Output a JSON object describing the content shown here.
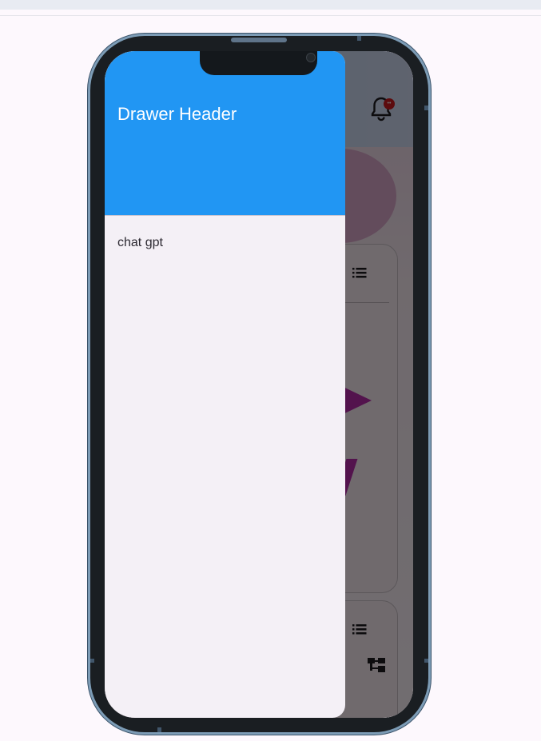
{
  "drawer": {
    "header_title": "Drawer Header",
    "items": [
      {
        "label": "chat gpt"
      }
    ]
  },
  "app": {
    "notification_badge": "••",
    "icons": [
      "bell-icon",
      "list-icon",
      "play-icon",
      "tree-icon",
      "camera-icon"
    ]
  },
  "colors": {
    "drawer_header": "#2196f3",
    "drawer_background": "#f4f0f6",
    "scrim": "rgba(0,0,0,0.54)",
    "accent_shape": "#b52aa8",
    "badge": "#c8191f"
  }
}
